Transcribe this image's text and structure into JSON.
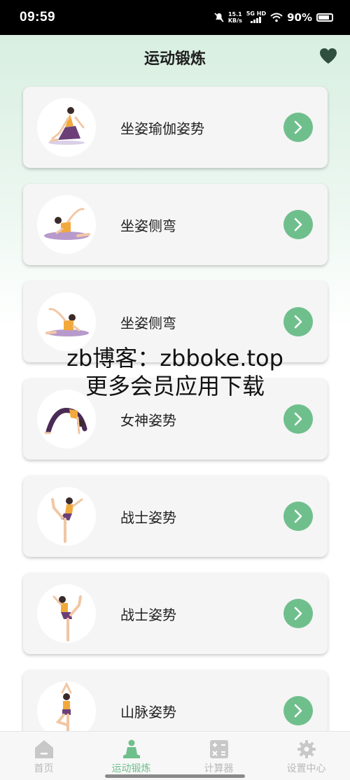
{
  "status_bar": {
    "time": "09:59",
    "net_speed_value": "15.1",
    "net_speed_unit": "KB/s",
    "network": "5G HD",
    "battery": "90%"
  },
  "header": {
    "title": "运动锻炼",
    "favorite_icon": "heart-icon"
  },
  "exercises": [
    {
      "title": "坐姿瑜伽姿势",
      "pose_icon": "yoga-seated-twist-icon"
    },
    {
      "title": "坐姿侧弯",
      "pose_icon": "yoga-seated-side-bend-icon"
    },
    {
      "title": "坐姿侧弯",
      "pose_icon": "yoga-seated-side-bend-icon"
    },
    {
      "title": "女神姿势",
      "pose_icon": "yoga-wheel-pose-icon"
    },
    {
      "title": "战士姿势",
      "pose_icon": "yoga-dancer-pose-icon"
    },
    {
      "title": "战士姿势",
      "pose_icon": "yoga-dancer-pose-icon"
    },
    {
      "title": "山脉姿势",
      "pose_icon": "yoga-tree-pose-icon"
    }
  ],
  "watermark": {
    "line1": "zb博客：zbboke.top",
    "line2": "更多会员应用下载"
  },
  "tabbar": [
    {
      "label": "首页",
      "icon": "home-icon",
      "active": false
    },
    {
      "label": "运动锻炼",
      "icon": "meditation-icon",
      "active": true
    },
    {
      "label": "计算器",
      "icon": "calculator-icon",
      "active": false
    },
    {
      "label": "设置中心",
      "icon": "gear-icon",
      "active": false
    }
  ],
  "colors": {
    "accent": "#6fbf8c",
    "header_gradient_top": "#d8efe1",
    "heart": "#2f4f3f"
  }
}
